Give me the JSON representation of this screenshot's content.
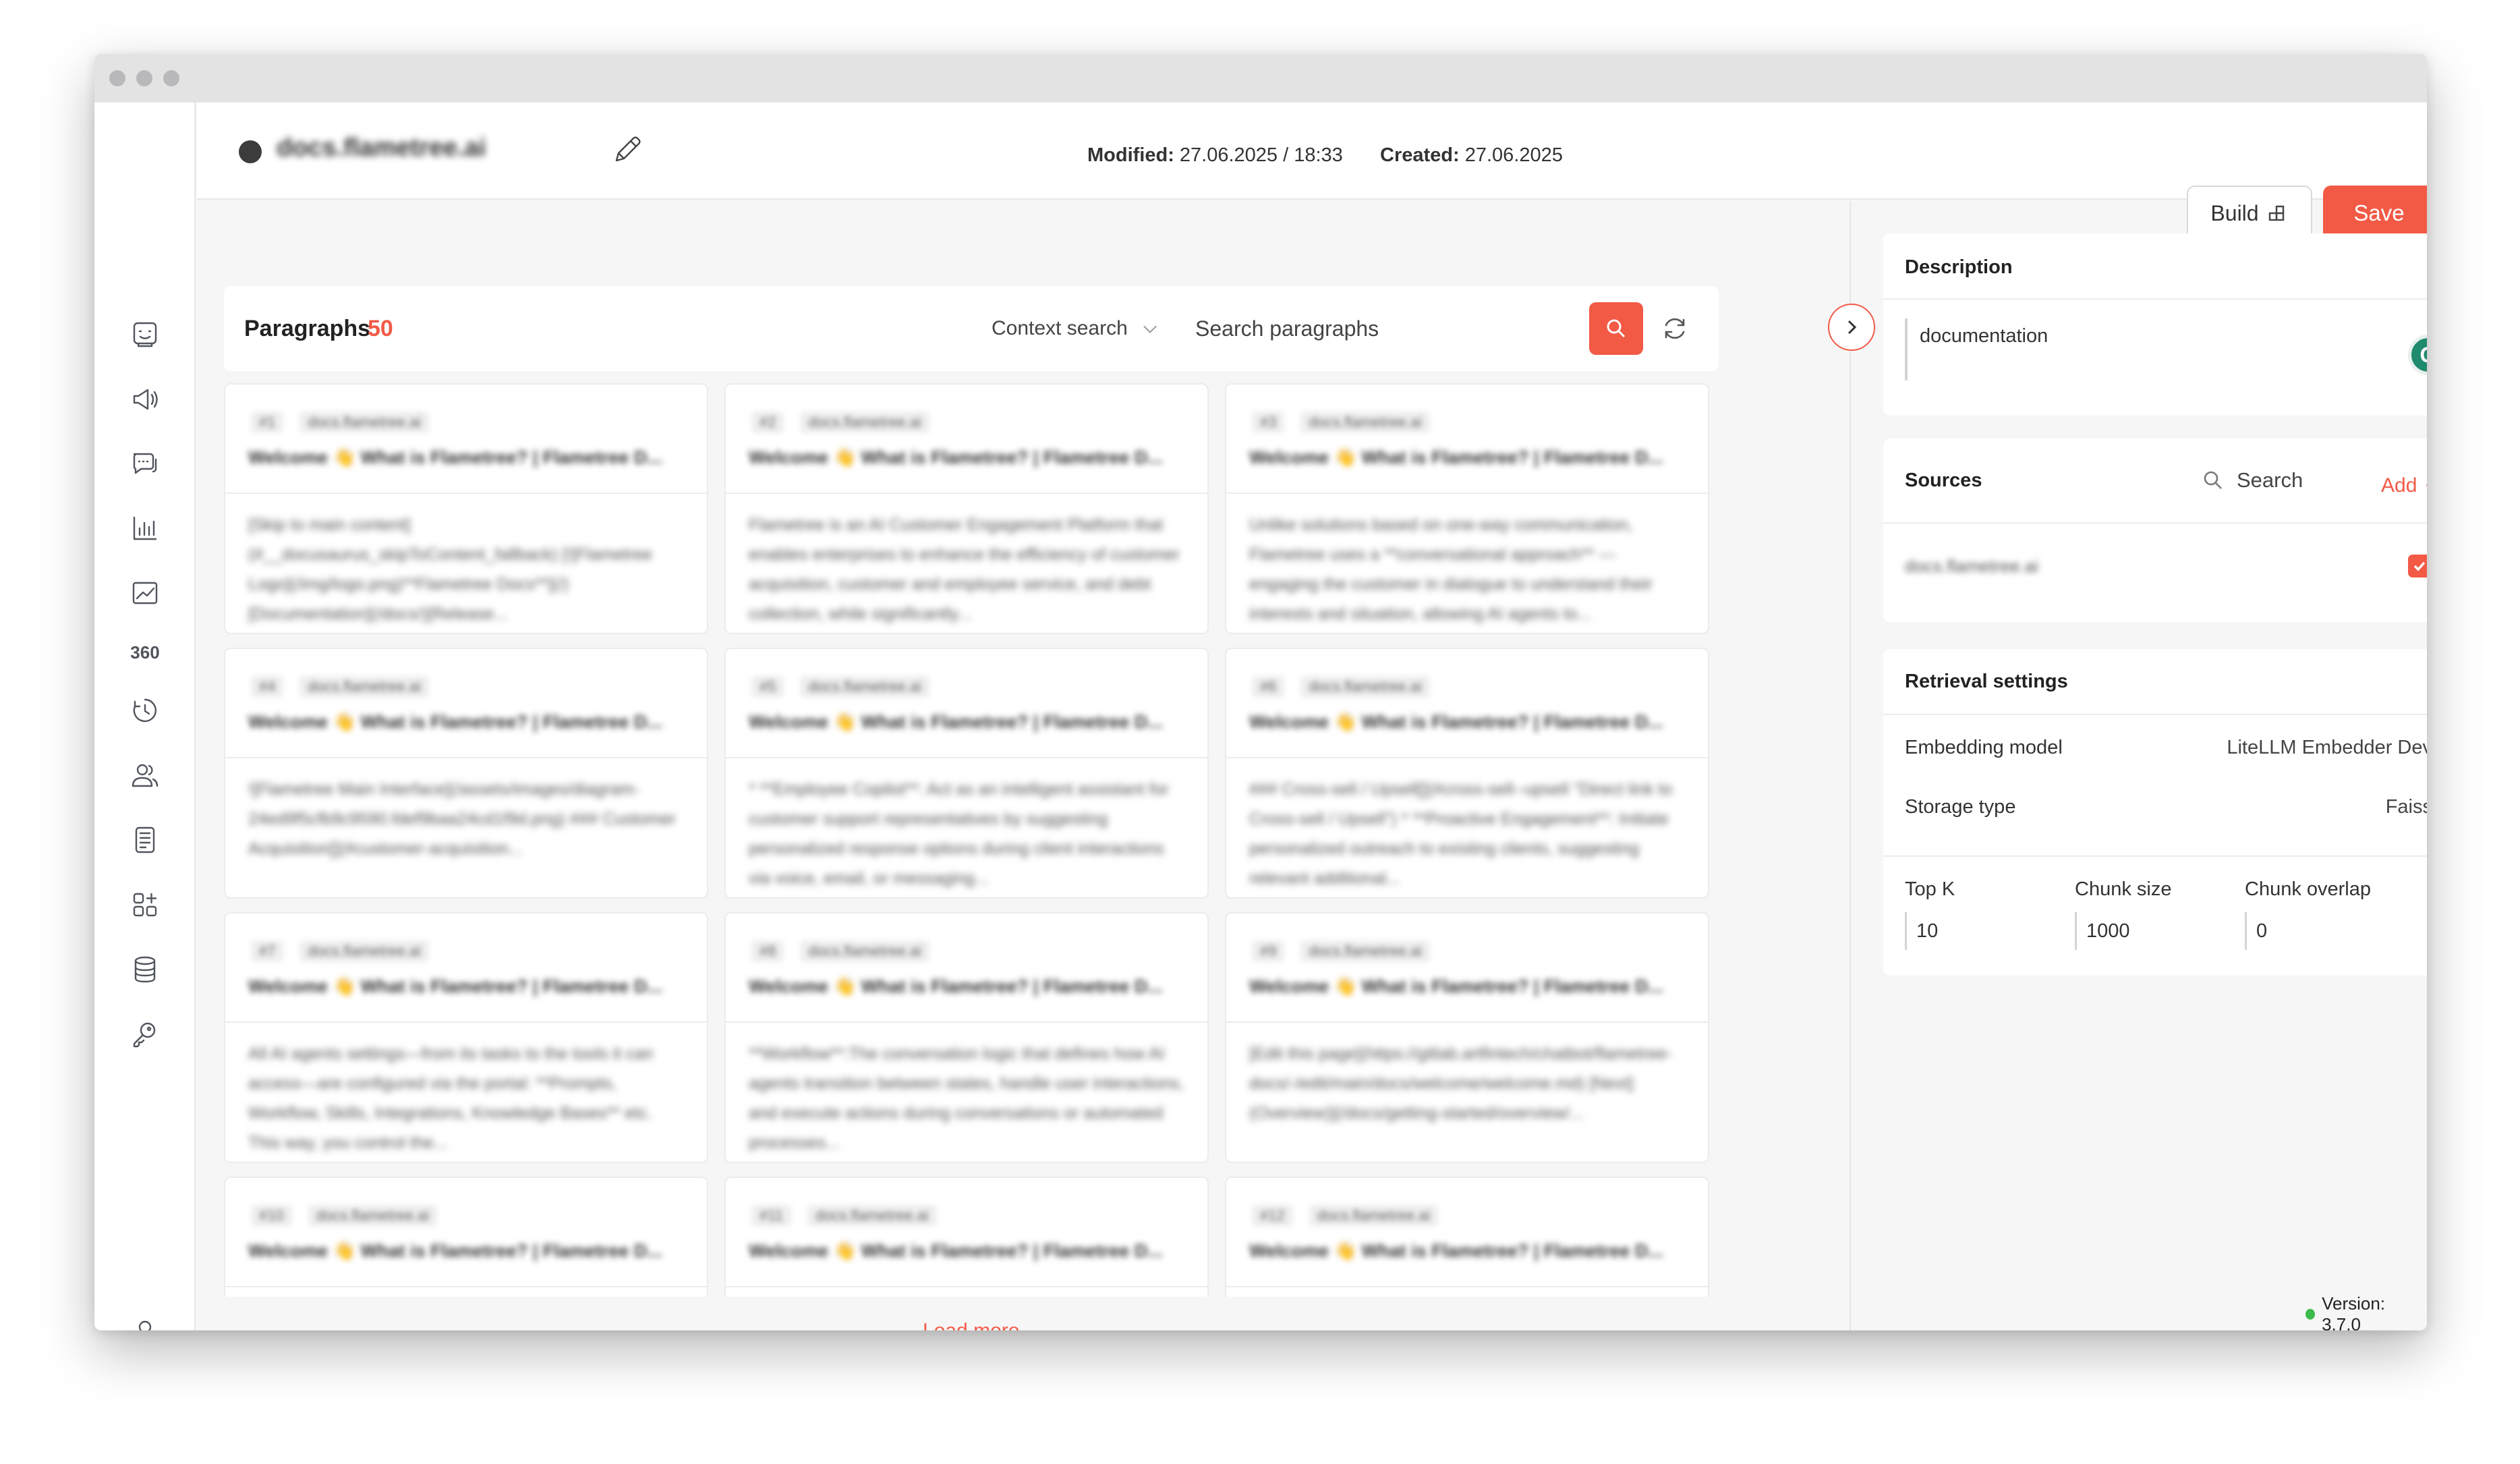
{
  "header": {
    "doc_title": "docs.flametree.ai",
    "modified_label": "Modified:",
    "modified_value": "27.06.2025 / 18:33",
    "created_label": "Created:",
    "created_value": "27.06.2025",
    "build_label": "Build",
    "save_label": "Save"
  },
  "sidebar": {
    "items": [
      {
        "icon": "robot-face-icon"
      },
      {
        "icon": "megaphone-icon"
      },
      {
        "icon": "chat-bubbles-icon"
      },
      {
        "icon": "bar-chart-icon"
      },
      {
        "icon": "line-chart-icon"
      },
      {
        "icon": "360-icon",
        "label": "360"
      },
      {
        "icon": "history-icon"
      },
      {
        "icon": "users-icon"
      },
      {
        "icon": "document-icon"
      },
      {
        "icon": "apps-grid-icon"
      },
      {
        "icon": "database-icon"
      },
      {
        "icon": "key-icon"
      }
    ],
    "footer_icon": "user-profile-icon"
  },
  "paragraphs": {
    "title": "Paragraphs",
    "count": "50",
    "context_search": "Context search",
    "search_placeholder": "Search paragraphs",
    "load_more": "Load more",
    "cards": [
      {
        "id": "#1",
        "source": "docs.flametree.ai",
        "title": "Welcome 👋 What is Flametree? | Flametree D...",
        "text": "[Skip to main content](#__docusaurus_skipToContent_fallback) [![Flametree Logo](/img/logo.png)**Flametree Docs**](/)[Documentation](/docs/)[Release..."
      },
      {
        "id": "#2",
        "source": "docs.flametree.ai",
        "title": "Welcome 👋 What is Flametree? | Flametree D...",
        "text": "Flametree is an AI Customer Engagement Platform that enables enterprises to enhance the efficiency of customer acquisition, customer and employee service, and debt collection, while significantly..."
      },
      {
        "id": "#3",
        "source": "docs.flametree.ai",
        "title": "Welcome 👋 What is Flametree? | Flametree D...",
        "text": "Unlike solutions based on one-way communication, Flametree uses a **conversational approach** — engaging the customer in dialogue to understand their interests and situation, allowing AI agents to..."
      },
      {
        "id": "#4",
        "source": "docs.flametree.ai",
        "title": "Welcome 👋 What is Flametree? | Flametree D...",
        "text": "![Flametree Main Interface](/assets/images/diagram-24ed9f5cfb9c9590.fdef9baa24cd1f9d.png) ### Customer Acquisition[](#customer-acquisition..."
      },
      {
        "id": "#5",
        "source": "docs.flametree.ai",
        "title": "Welcome 👋 What is Flametree? | Flametree D...",
        "text": "* **Employee Copilot**: Act as an intelligent assistant for customer support representatives by suggesting personalized response options during client interactions via voice, email, or messaging..."
      },
      {
        "id": "#6",
        "source": "docs.flametree.ai",
        "title": "Welcome 👋 What is Flametree? | Flametree D...",
        "text": "### Cross-sell / Upsell[](#cross-sell--upsell \"Direct link to Cross-sell / Upsell\") * **Proactive Engagement**: Initiate personalized outreach to existing clients, suggesting relevant additional..."
      },
      {
        "id": "#7",
        "source": "docs.flametree.ai",
        "title": "Welcome 👋 What is Flametree? | Flametree D...",
        "text": "All AI agents settings—from its tasks to the tools it can access—are configured via the portal: **Prompts, Workflow, Skills, Integrations, Knowledge Bases** etc. This way, you control the..."
      },
      {
        "id": "#8",
        "source": "docs.flametree.ai",
        "title": "Welcome 👋 What is Flametree? | Flametree D...",
        "text": "**Workflow**:The conversation logic that defines how AI agents transition between states, handle user interactions, and execute actions during conversations or automated processes..."
      },
      {
        "id": "#9",
        "source": "docs.flametree.ai",
        "title": "Welcome 👋 What is Flametree? | Flametree D...",
        "text": "[Edit this page](https://gitlab.artfintech/chatbot/flametree-docs/-/edit/main/docs/welcome/welcome.md) [Next](Overview)](/docs/getting-started/overview/..."
      },
      {
        "id": "#10",
        "source": "docs.flametree.ai",
        "title": "Welcome 👋 What is Flametree? | Flametree D...",
        "text": ""
      },
      {
        "id": "#11",
        "source": "docs.flametree.ai",
        "title": "Welcome 👋 What is Flametree? | Flametree D...",
        "text": ""
      },
      {
        "id": "#12",
        "source": "docs.flametree.ai",
        "title": "Welcome 👋 What is Flametree? | Flametree D...",
        "text": ""
      }
    ]
  },
  "description": {
    "title": "Description",
    "value": "documentation"
  },
  "sources": {
    "title": "Sources",
    "search_label": "Search",
    "add_label": "Add",
    "add_symbol": "+",
    "items": [
      {
        "name": "docs.flametree.ai",
        "checked": true
      }
    ]
  },
  "retrieval": {
    "title": "Retrieval settings",
    "embedding_label": "Embedding model",
    "embedding_value": "LiteLLM Embedder Dev",
    "storage_label": "Storage type",
    "storage_value": "Faiss",
    "topk_label": "Top K",
    "topk_value": "10",
    "chunk_size_label": "Chunk size",
    "chunk_size_value": "1000",
    "chunk_overlap_label": "Chunk overlap",
    "chunk_overlap_value": "0"
  },
  "footer": {
    "version": "Version: 3.7.0"
  },
  "colors": {
    "accent": "#f25a46",
    "status_ok": "#3dbb4a",
    "grammarly": "#1e8a6e"
  }
}
